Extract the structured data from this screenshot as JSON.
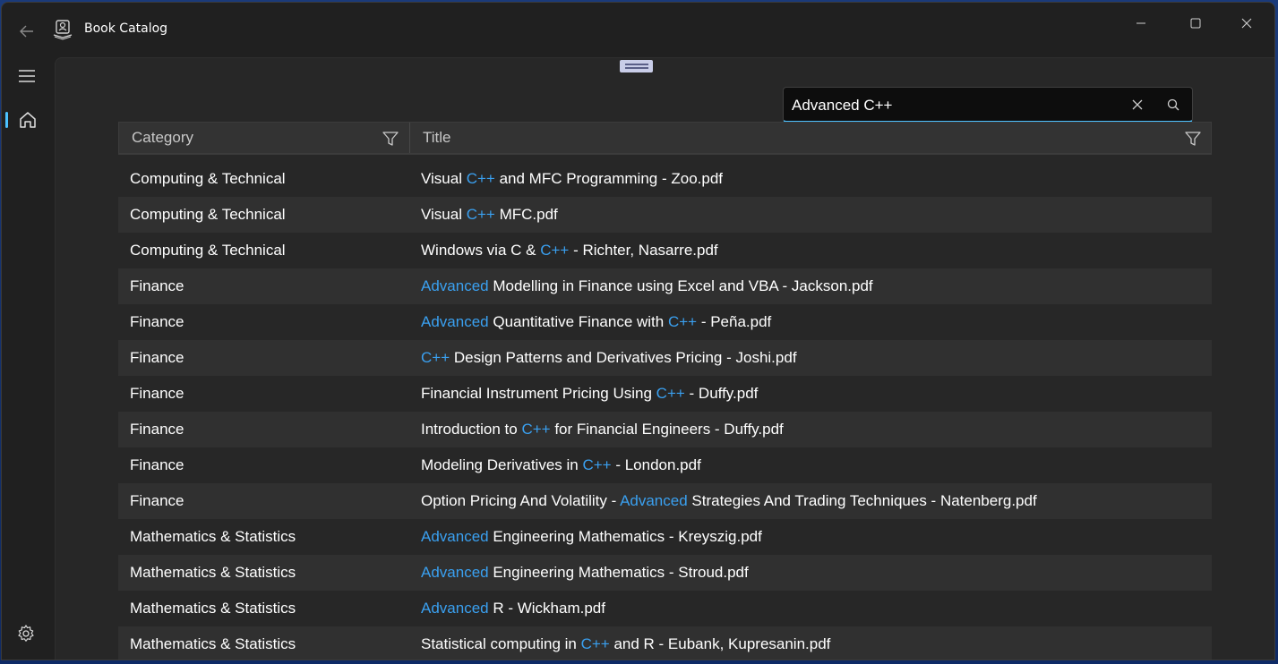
{
  "window": {
    "title": "Book Catalog"
  },
  "search": {
    "query": "Advanced C++"
  },
  "grid": {
    "columns": [
      "Category",
      "Title"
    ],
    "rows": [
      {
        "category": "Computing & Technical",
        "title": [
          "Visual ",
          "C++",
          " and MFC Programming - Zoo.pdf"
        ]
      },
      {
        "category": "Computing & Technical",
        "title": [
          "Visual ",
          "C++",
          " MFC.pdf"
        ]
      },
      {
        "category": "Computing & Technical",
        "title": [
          "Windows via C & ",
          "C++",
          " - Richter, Nasarre.pdf"
        ]
      },
      {
        "category": "Finance",
        "title": [
          "",
          "Advanced",
          " Modelling in Finance using Excel and VBA - Jackson.pdf"
        ]
      },
      {
        "category": "Finance",
        "title": [
          "",
          "Advanced",
          " Quantitative Finance with ",
          "C++",
          " - Peña.pdf"
        ]
      },
      {
        "category": "Finance",
        "title": [
          "",
          "C++",
          " Design Patterns and Derivatives Pricing - Joshi.pdf"
        ]
      },
      {
        "category": "Finance",
        "title": [
          "Financial Instrument Pricing Using ",
          "C++",
          " - Duffy.pdf"
        ]
      },
      {
        "category": "Finance",
        "title": [
          "Introduction to ",
          "C++",
          " for Financial Engineers - Duffy.pdf"
        ]
      },
      {
        "category": "Finance",
        "title": [
          "Modeling Derivatives in ",
          "C++",
          " - London.pdf"
        ]
      },
      {
        "category": "Finance",
        "title": [
          "Option Pricing And Volatility - ",
          "Advanced",
          " Strategies And Trading Techniques - Natenberg.pdf"
        ]
      },
      {
        "category": "Mathematics & Statistics",
        "title": [
          "",
          "Advanced",
          " Engineering Mathematics - Kreyszig.pdf"
        ]
      },
      {
        "category": "Mathematics & Statistics",
        "title": [
          "",
          "Advanced",
          " Engineering Mathematics - Stroud.pdf"
        ]
      },
      {
        "category": "Mathematics & Statistics",
        "title": [
          "",
          "Advanced",
          " R - Wickham.pdf"
        ]
      },
      {
        "category": "Mathematics & Statistics",
        "title": [
          "Statistical computing in ",
          "C++",
          " and R - Eubank, Kupresanin.pdf"
        ]
      }
    ]
  },
  "icons": {
    "back": "back-arrow-icon",
    "app": "book-reader-icon",
    "menu": "hamburger-icon",
    "home": "home-icon",
    "settings": "gear-icon",
    "minimize": "minimize-icon",
    "maximize": "maximize-icon",
    "close": "close-icon",
    "clear": "clear-icon",
    "search": "search-icon",
    "filter": "filter-icon"
  },
  "colors": {
    "accent": "#4cc2ff",
    "highlight": "#3aa0f0"
  }
}
